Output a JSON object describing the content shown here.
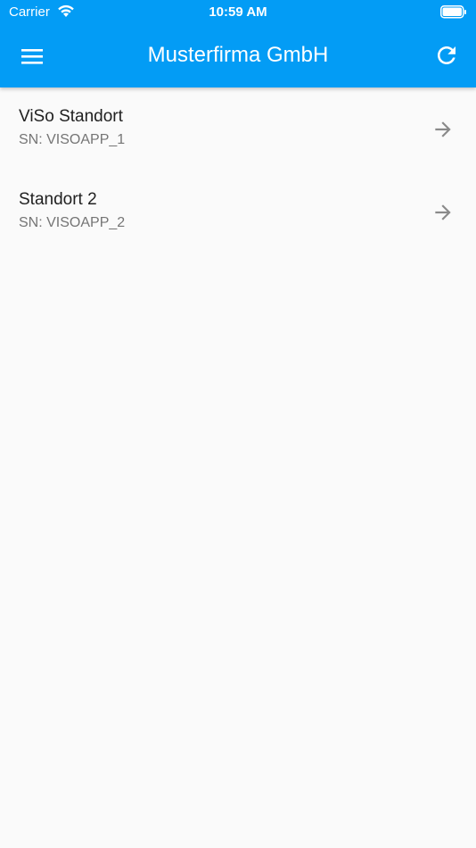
{
  "status_bar": {
    "carrier": "Carrier",
    "time": "10:59 AM"
  },
  "header": {
    "title": "Musterfirma GmbH",
    "menu_icon": "menu-icon",
    "refresh_icon": "refresh-icon"
  },
  "locations": [
    {
      "name": "ViSo Standort",
      "serial": "SN: VISOAPP_1"
    },
    {
      "name": "Standort 2",
      "serial": "SN: VISOAPP_2"
    }
  ],
  "colors": {
    "app_bar": "#039cf5",
    "background": "#fafafa",
    "primary_text": "#212121",
    "secondary_text": "#757575",
    "arrow": "#8a8a8a"
  }
}
